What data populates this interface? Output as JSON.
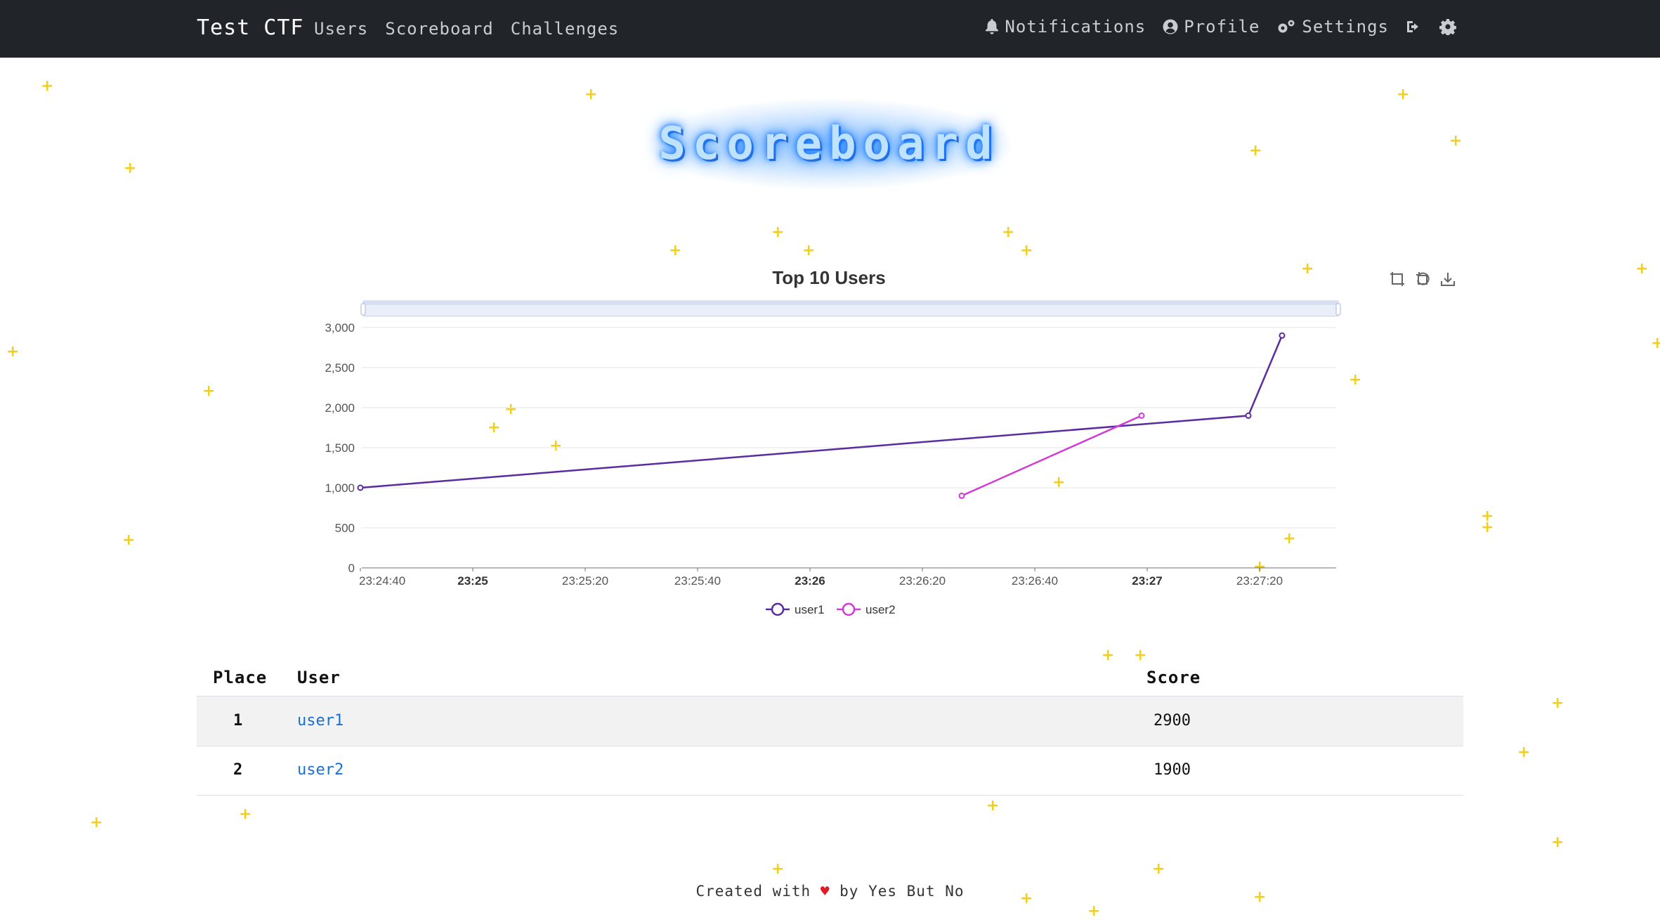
{
  "navbar": {
    "brand": "Test CTF",
    "left_links": [
      "Users",
      "Scoreboard",
      "Challenges"
    ],
    "notifications": "Notifications",
    "profile": "Profile",
    "settings": "Settings"
  },
  "page_title": "Scoreboard",
  "chart_data": {
    "type": "line",
    "title": "Top 10 Users",
    "x_ticks": [
      "23:24:40",
      "23:25",
      "23:25:20",
      "23:25:40",
      "23:26",
      "23:26:20",
      "23:26:40",
      "23:27",
      "23:27:20"
    ],
    "y_ticks": [
      "0",
      "500",
      "1,000",
      "1,500",
      "2,000",
      "2,500",
      "3,000"
    ],
    "ylim": [
      0,
      3000
    ],
    "series": [
      {
        "name": "user1",
        "color": "#5b2c9f",
        "x": [
          "23:24:40",
          "23:27:18",
          "23:27:24"
        ],
        "y": [
          1000,
          1900,
          2900
        ]
      },
      {
        "name": "user2",
        "color": "#d23ad6",
        "x": [
          "23:26:27",
          "23:26:59"
        ],
        "y": [
          900,
          1900
        ]
      }
    ],
    "legend": "bottom-center",
    "grid": true
  },
  "table": {
    "headers": [
      "Place",
      "User",
      "Score"
    ],
    "rows": [
      {
        "place": "1",
        "user": "user1",
        "score": "2900"
      },
      {
        "place": "2",
        "user": "user2",
        "score": "1900"
      }
    ]
  },
  "footer": {
    "prefix": "Created with",
    "heart": "♥",
    "suffix": "by Yes But No"
  }
}
